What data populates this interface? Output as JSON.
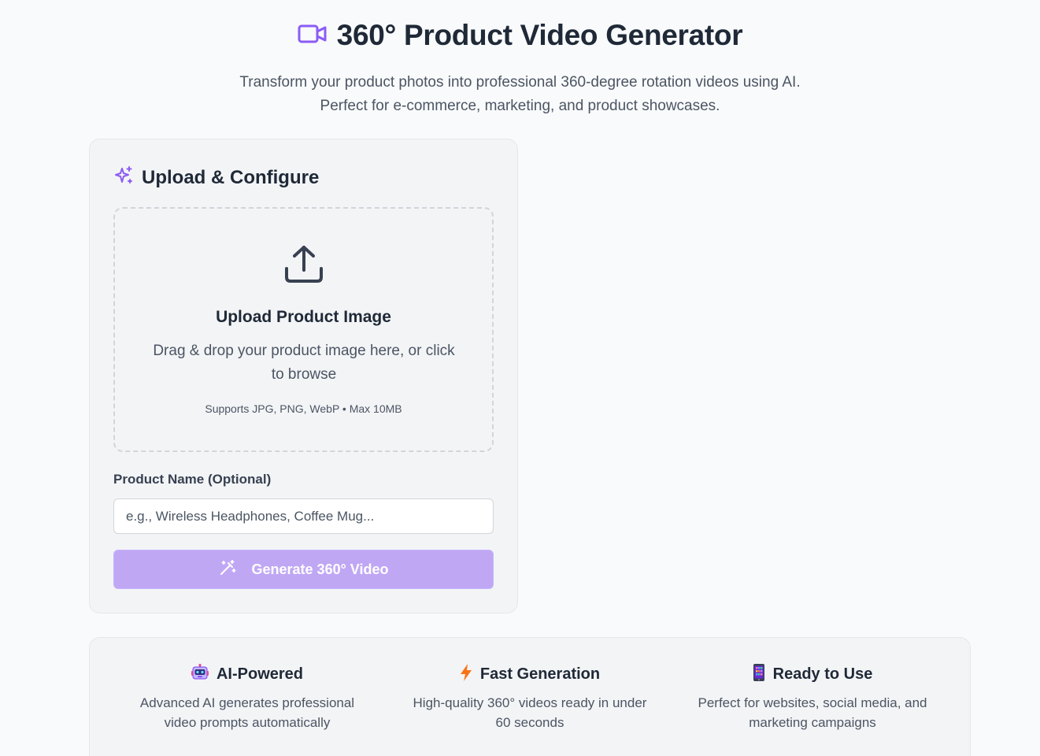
{
  "header": {
    "title": "360° Product Video Generator",
    "subtitle_line1": "Transform your product photos into professional 360-degree rotation videos using AI.",
    "subtitle_line2": "Perfect for e-commerce, marketing, and product showcases.",
    "icon": "video-camera-icon"
  },
  "upload_card": {
    "title": "Upload & Configure",
    "icon": "sparkles-icon",
    "dropzone": {
      "icon": "upload-icon",
      "title": "Upload Product Image",
      "text": "Drag & drop your product image here, or click to browse",
      "hint": "Supports JPG, PNG, WebP • Max 10MB"
    },
    "product_name": {
      "label": "Product Name (Optional)",
      "placeholder": "e.g., Wireless Headphones, Coffee Mug...",
      "value": ""
    },
    "generate_button": {
      "label": "Generate 360° Video",
      "icon": "magic-wand-icon"
    }
  },
  "features": [
    {
      "icon": "robot-emoji",
      "title": "AI-Powered",
      "desc_line1": "Advanced AI generates professional",
      "desc_line2": "video prompts automatically"
    },
    {
      "icon": "lightning-emoji",
      "title": "Fast Generation",
      "desc_line1": "High-quality 360° videos ready in under",
      "desc_line2": "60 seconds"
    },
    {
      "icon": "mobile-phone-emoji",
      "title": "Ready to Use",
      "desc_line1": "Perfect for websites, social media, and",
      "desc_line2": "marketing campaigns"
    }
  ],
  "colors": {
    "accent": "#8b5cf6",
    "button_disabled": "#c0a7f4",
    "background": "#f9fafb",
    "card": "#f3f4f6"
  }
}
